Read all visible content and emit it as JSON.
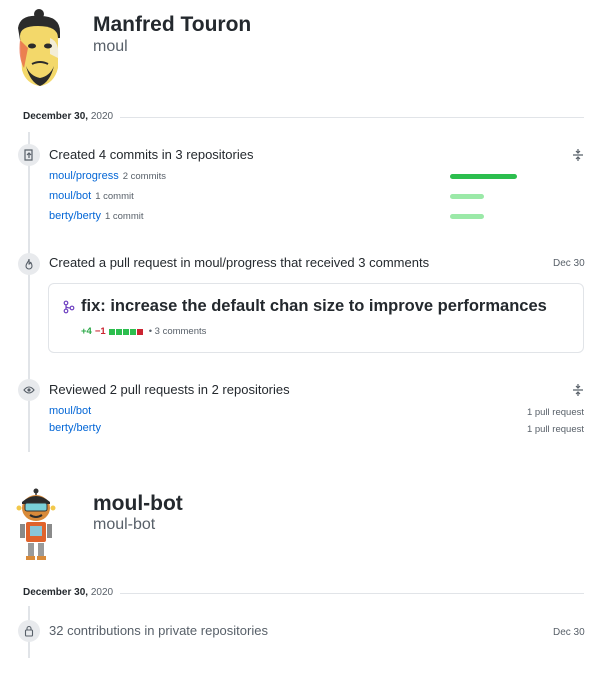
{
  "users": [
    {
      "name": "Manfred Touron",
      "login": "moul",
      "date": {
        "day": "December 30,",
        "year": "2020"
      },
      "events": {
        "commits": {
          "title": "Created 4 commits in 3 repositories",
          "icon": "repo-push-icon",
          "repos": [
            {
              "name": "moul/progress",
              "count": "2 commits",
              "share": 1.0
            },
            {
              "name": "moul/bot",
              "count": "1 commit",
              "share": 0.5
            },
            {
              "name": "berty/berty",
              "count": "1 commit",
              "share": 0.5
            }
          ]
        },
        "pull_request": {
          "title": "Created a pull request in moul/progress that received 3 comments",
          "date": "Dec 30",
          "icon": "flame-icon",
          "pr_title": "fix: increase the default chan size to improve performances",
          "additions": "+4",
          "deletions": "−1",
          "comments": "• 3 comments",
          "diffstat": [
            "green",
            "green",
            "green",
            "green",
            "red"
          ]
        },
        "reviews": {
          "title": "Reviewed 2 pull requests in 2 repositories",
          "icon": "eye-icon",
          "repos": [
            {
              "name": "moul/bot",
              "count": "1 pull request"
            },
            {
              "name": "berty/berty",
              "count": "1 pull request"
            }
          ]
        }
      }
    },
    {
      "name": "moul-bot",
      "login": "moul-bot",
      "date": {
        "day": "December 30,",
        "year": "2020"
      },
      "events": {
        "private": {
          "title": "32 contributions in private repositories",
          "date": "Dec 30",
          "icon": "lock-icon"
        }
      }
    }
  ],
  "colors": {
    "bar_dark": "#2cbe4e",
    "bar_light": "#9be9a8",
    "link": "#0366d6",
    "diff_green": "#2cbe4e",
    "diff_red": "#cb2431"
  }
}
